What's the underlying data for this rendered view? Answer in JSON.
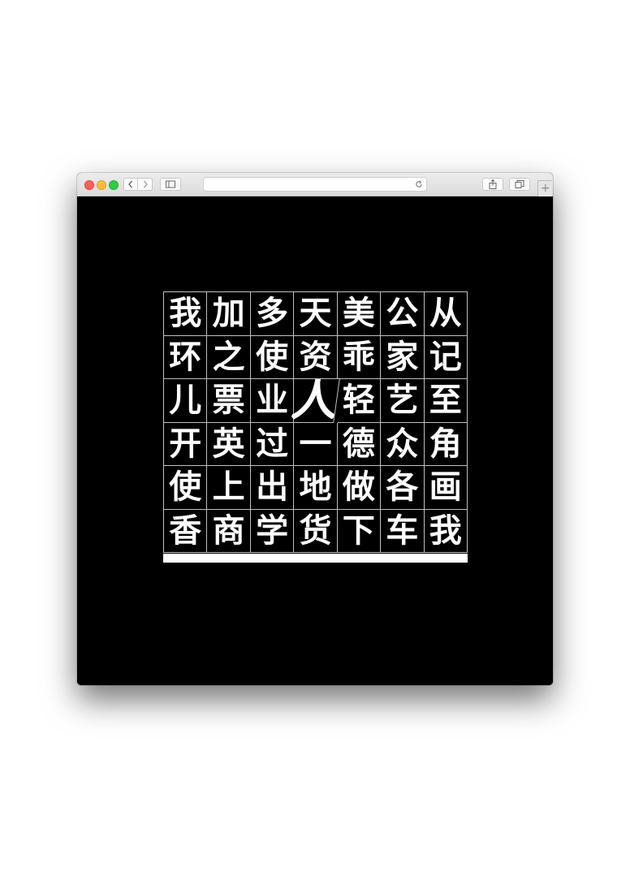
{
  "browser": {
    "address_bar": {
      "value": ""
    },
    "icons": [
      "chevron-left-icon",
      "chevron-right-icon",
      "sidebar-icon",
      "reload-icon",
      "share-icon",
      "tabs-icon",
      "plus-icon"
    ]
  },
  "grid": {
    "rows": [
      [
        "我",
        "加",
        "多",
        "天",
        "美",
        "公",
        "从"
      ],
      [
        "环",
        "之",
        "使",
        "资",
        "乖",
        "家",
        "记"
      ],
      [
        "儿",
        "票",
        "业",
        "人",
        "轻",
        "艺",
        "至"
      ],
      [
        "开",
        "英",
        "过",
        "一",
        "德",
        "众",
        "角"
      ],
      [
        "使",
        "上",
        "出",
        "地",
        "做",
        "各",
        "画"
      ],
      [
        "香",
        "商",
        "学",
        "货",
        "下",
        "车",
        "我"
      ]
    ],
    "highlighted": {
      "row": 2,
      "col": 3,
      "char": "人"
    }
  },
  "colors": {
    "background": "#000000",
    "text": "#ffffff",
    "grid_line": "#bfbfbf"
  }
}
